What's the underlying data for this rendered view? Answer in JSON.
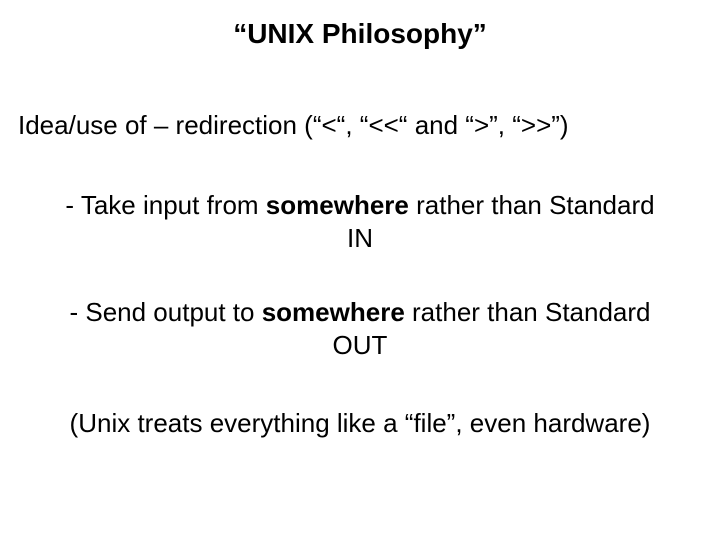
{
  "title": "“UNIX Philosophy”",
  "subtitle": "Idea/use of – redirection (“<“, “<<“ and “>”, “>>”)",
  "bullet1_prefix": "- Take input from ",
  "bullet1_bold": "somewhere",
  "bullet1_suffix": " rather than Standard IN",
  "bullet2_prefix": "-  Send output to ",
  "bullet2_bold": "somewhere",
  "bullet2_suffix": " rather than Standard OUT",
  "footnote": "(Unix treats everything like a “file”, even hardware)"
}
